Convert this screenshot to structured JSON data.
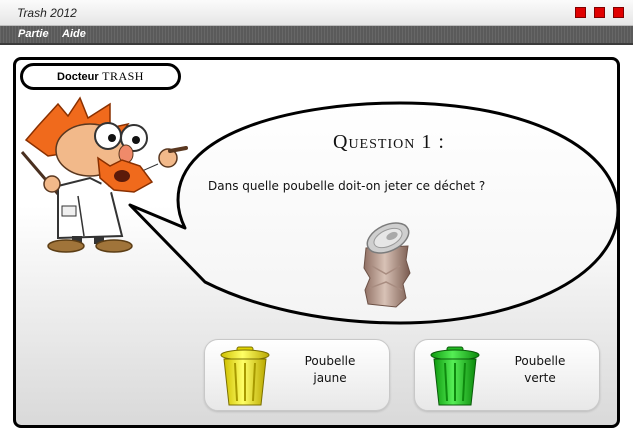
{
  "window": {
    "title": "Trash 2012"
  },
  "menu": {
    "items": [
      "Partie",
      "Aide"
    ]
  },
  "character": {
    "name_bold": "Docteur",
    "name_rest": "TRASH"
  },
  "question": {
    "title": "Question 1 :",
    "text": "Dans quelle poubelle doit-on jeter ce déchet ?",
    "item_icon": "crushed-can-icon"
  },
  "answers": [
    {
      "line1": "Poubelle",
      "line2": "jaune",
      "color": "#f2e600",
      "icon": "yellow-bin-icon"
    },
    {
      "line1": "Poubelle",
      "line2": "verte",
      "color": "#22cc22",
      "icon": "green-bin-icon"
    }
  ],
  "colors": {
    "window_buttons": "#e00000",
    "menubar": "#5a5a5a"
  }
}
